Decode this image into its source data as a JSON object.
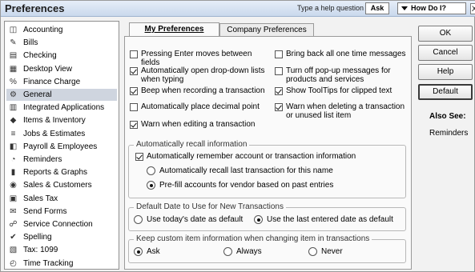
{
  "window": {
    "title": "Preferences",
    "help_prompt": "Type a help question",
    "ask_label": "Ask",
    "how_do_i_label": "How Do I?",
    "close_label": "X"
  },
  "sidebar": {
    "items": [
      {
        "label": "Accounting",
        "icon": "accounting-icon",
        "glyph": "◫",
        "selected": false
      },
      {
        "label": "Bills",
        "icon": "bills-icon",
        "glyph": "✎",
        "selected": false
      },
      {
        "label": "Checking",
        "icon": "checking-icon",
        "glyph": "▤",
        "selected": false
      },
      {
        "label": "Desktop View",
        "icon": "desktop-view-icon",
        "glyph": "▦",
        "selected": false
      },
      {
        "label": "Finance Charge",
        "icon": "finance-charge-icon",
        "glyph": "%",
        "selected": false
      },
      {
        "label": "General",
        "icon": "general-icon",
        "glyph": "⚙",
        "selected": true
      },
      {
        "label": "Integrated Applications",
        "icon": "integrated-applications-icon",
        "glyph": "▥",
        "selected": false
      },
      {
        "label": "Items & Inventory",
        "icon": "items-inventory-icon",
        "glyph": "◆",
        "selected": false
      },
      {
        "label": "Jobs & Estimates",
        "icon": "jobs-estimates-icon",
        "glyph": "≡",
        "selected": false
      },
      {
        "label": "Payroll & Employees",
        "icon": "payroll-employees-icon",
        "glyph": "◧",
        "selected": false
      },
      {
        "label": "Reminders",
        "icon": "reminders-icon",
        "glyph": "◔",
        "selected": false
      },
      {
        "label": "Reports & Graphs",
        "icon": "reports-graphs-icon",
        "glyph": "▮",
        "selected": false
      },
      {
        "label": "Sales & Customers",
        "icon": "sales-customers-icon",
        "glyph": "◉",
        "selected": false
      },
      {
        "label": "Sales Tax",
        "icon": "sales-tax-icon",
        "glyph": "▣",
        "selected": false
      },
      {
        "label": "Send Forms",
        "icon": "send-forms-icon",
        "glyph": "✉",
        "selected": false
      },
      {
        "label": "Service Connection",
        "icon": "service-connection-icon",
        "glyph": "☍",
        "selected": false
      },
      {
        "label": "Spelling",
        "icon": "spelling-icon",
        "glyph": "✔",
        "selected": false
      },
      {
        "label": "Tax: 1099",
        "icon": "tax-1099-icon",
        "glyph": "▧",
        "selected": false
      },
      {
        "label": "Time Tracking",
        "icon": "time-tracking-icon",
        "glyph": "◴",
        "selected": false
      }
    ]
  },
  "tabs": {
    "my_preferences": "My Preferences",
    "company_preferences": "Company Preferences"
  },
  "checkboxes": {
    "pressing_enter": {
      "label": "Pressing Enter moves between fields",
      "checked": false
    },
    "bring_back": {
      "label": "Bring back all one time messages",
      "checked": false
    },
    "auto_open_dropdown": {
      "label": "Automatically open drop-down lists when typing",
      "checked": true
    },
    "turn_off_popup": {
      "label": "Turn off pop-up messages for products and services",
      "checked": false
    },
    "beep": {
      "label": "Beep when recording a transaction",
      "checked": true
    },
    "show_tooltips": {
      "label": "Show ToolTips for clipped text",
      "checked": true
    },
    "auto_decimal": {
      "label": "Automatically place decimal point",
      "checked": false
    },
    "warn_delete": {
      "label": "Warn when deleting a transaction or unused list item",
      "checked": true
    },
    "warn_editing": {
      "label": "Warn when editing a transaction",
      "checked": true
    }
  },
  "recall_group": {
    "legend": "Automatically recall information",
    "auto_remember": {
      "label": "Automatically remember account or transaction information",
      "checked": true
    },
    "recall_last": {
      "label": "Automatically recall last transaction for this name",
      "selected": false
    },
    "prefill": {
      "label": "Pre-fill accounts for vendor based on past entries",
      "selected": true
    }
  },
  "default_date_group": {
    "legend": "Default Date to Use for New Transactions",
    "today": {
      "label": "Use today's date as default",
      "selected": false
    },
    "last_entered": {
      "label": "Use the last entered date as default",
      "selected": true
    }
  },
  "custom_item_group": {
    "legend": "Keep custom item information when changing item in transactions",
    "ask": {
      "label": "Ask",
      "selected": true
    },
    "always": {
      "label": "Always",
      "selected": false
    },
    "never": {
      "label": "Never",
      "selected": false
    }
  },
  "buttons": {
    "ok": "OK",
    "cancel": "Cancel",
    "help": "Help",
    "default": "Default"
  },
  "also_see": {
    "heading": "Also See:",
    "link": "Reminders"
  }
}
